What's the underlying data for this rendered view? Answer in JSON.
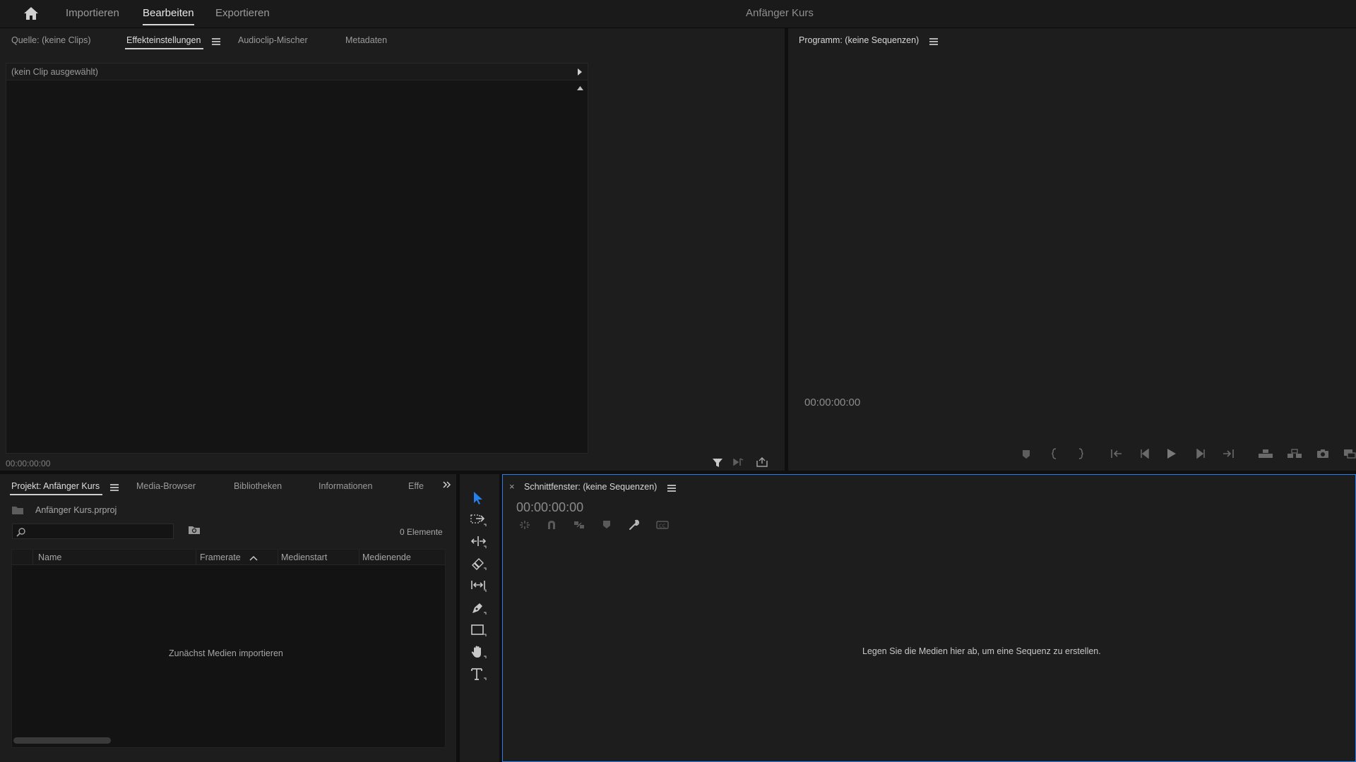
{
  "app": {
    "project_title": "Anfänger Kurs",
    "workspace_tabs": [
      {
        "label": "Importieren",
        "active": false
      },
      {
        "label": "Bearbeiten",
        "active": true
      },
      {
        "label": "Exportieren",
        "active": false
      }
    ]
  },
  "source_panel": {
    "tabs": [
      {
        "label": "Quelle: (keine Clips)"
      },
      {
        "label": "Effekteinstellungen",
        "active": true
      },
      {
        "label": "Audioclip-Mischer"
      },
      {
        "label": "Metadaten"
      }
    ],
    "no_clip_text": "(kein Clip ausgewählt)",
    "timecode": "00:00:00:00"
  },
  "program_monitor": {
    "title": "Programm: (keine Sequenzen)",
    "timecode": "00:00:00:00"
  },
  "project_panel": {
    "tabs": [
      {
        "label": "Projekt: Anfänger Kurs",
        "active": true
      },
      {
        "label": "Media-Browser"
      },
      {
        "label": "Bibliotheken"
      },
      {
        "label": "Informationen"
      },
      {
        "label": "Effe"
      }
    ],
    "file_name": "Anfänger Kurs.prproj",
    "item_count": "0 Elemente",
    "search_placeholder": "",
    "columns": [
      "Name",
      "Framerate",
      "Medienstart",
      "Medienende"
    ],
    "empty_text": "Zunächst Medien importieren"
  },
  "timeline": {
    "title": "Schnittfenster: (keine Sequenzen)",
    "close_glyph": "×",
    "timecode": "00:00:00:00",
    "empty_text": "Legen Sie die Medien hier ab, um eine Sequenz zu erstellen."
  },
  "colors": {
    "accent": "#2680eb",
    "panel_bg": "#1d1d1d",
    "app_bg": "#0f0f0f"
  },
  "icons": {
    "tools": [
      "selection-tool-icon",
      "track-select-tool-icon",
      "ripple-edit-tool-icon",
      "razor-tool-icon",
      "slip-tool-icon",
      "pen-tool-icon",
      "rectangle-tool-icon",
      "hand-tool-icon",
      "type-tool-icon"
    ]
  }
}
